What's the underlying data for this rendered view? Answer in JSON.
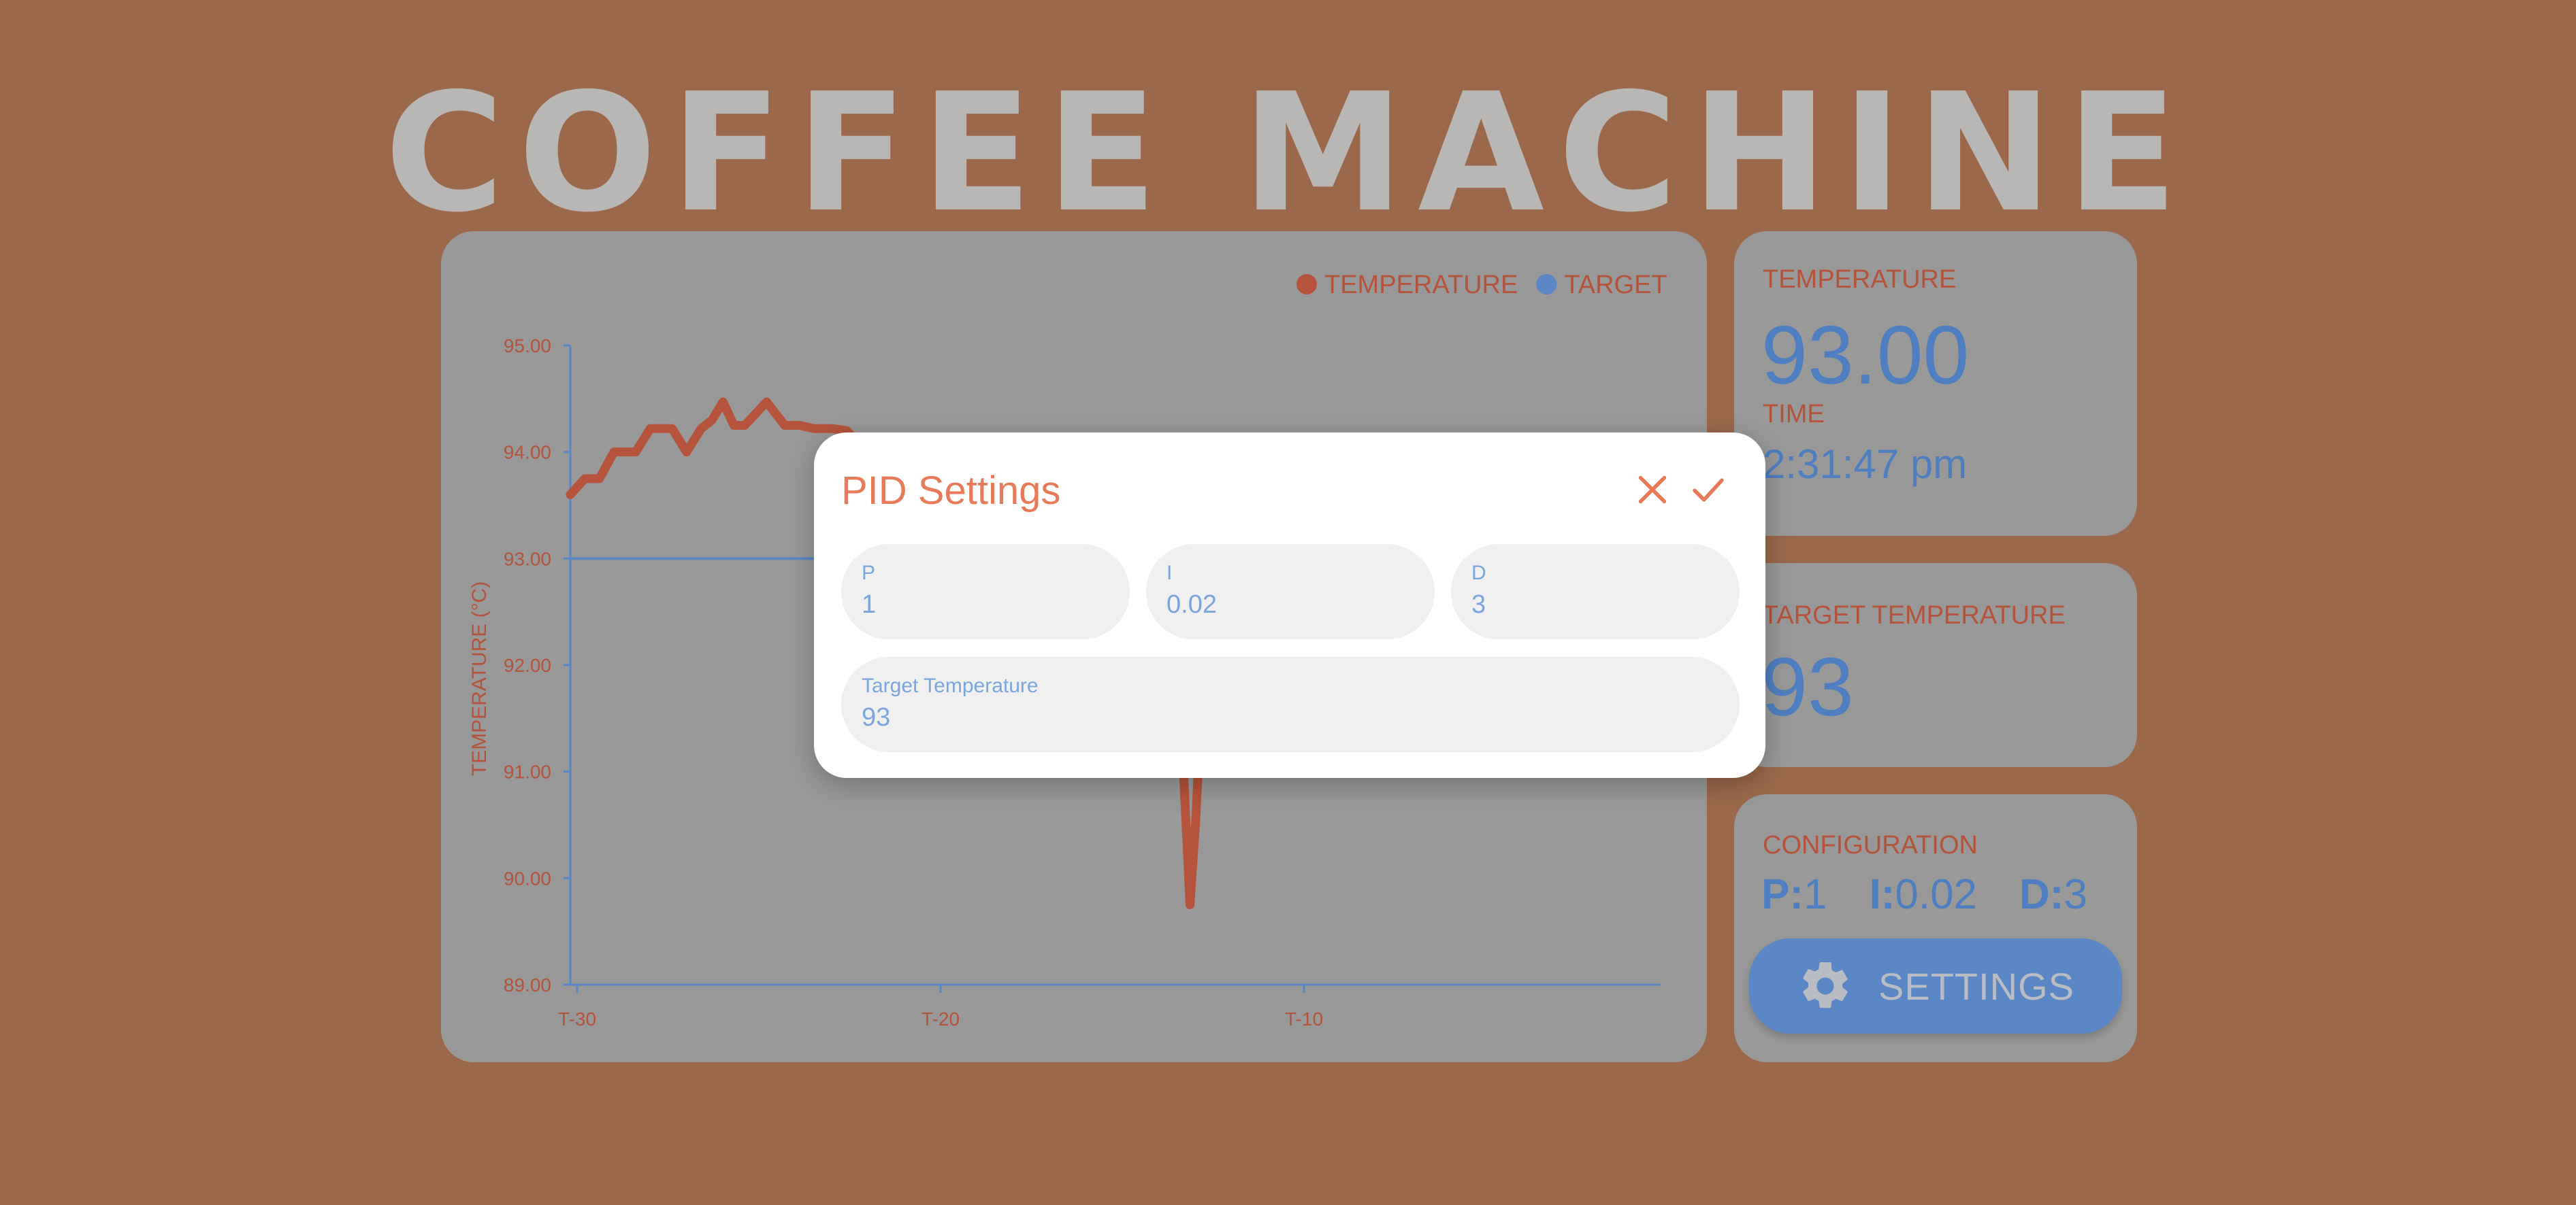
{
  "app_title": "COFFEE MACHINE",
  "colors": {
    "background": "#9b684b",
    "card": "#999999",
    "temperature_series": "#b5533c",
    "target_series": "#5b87c6",
    "accent_blue": "#4f7ec1",
    "dialog_accent": "#e77b59"
  },
  "chart_data": {
    "type": "line",
    "title": "",
    "xlabel": "",
    "ylabel": "TEMPERATURE (°C)",
    "ylim": [
      89,
      95
    ],
    "xlim": [
      -30,
      0
    ],
    "y_ticks": [
      "95.00",
      "94.00",
      "93.00",
      "92.00",
      "91.00",
      "90.00",
      "89.00"
    ],
    "x_ticks": [
      {
        "label": "T-30",
        "value": -30
      },
      {
        "label": "T-20",
        "value": -20
      },
      {
        "label": "T-10",
        "value": -10
      }
    ],
    "legend": {
      "placement": "top-right"
    },
    "series": [
      {
        "name": "TEMPERATURE",
        "color": "#b5533c",
        "x": [
          -30,
          -29.6,
          -29.2,
          -28.8,
          -28.2,
          -27.8,
          -27.2,
          -26.8,
          -26.4,
          -26.1,
          -25.8,
          -25.5,
          -25.2,
          -24.6,
          -24.1,
          -23.7,
          -23.3,
          -22.8,
          -22.4,
          -21.8,
          -21.3,
          -18.3,
          -14.8,
          -14.0,
          -13.5,
          -13.2,
          -12.95,
          -12.8,
          -12.6,
          -12.3,
          -11.8,
          -11.4
        ],
        "y": [
          93.6,
          93.75,
          93.75,
          94.0,
          94.0,
          94.22,
          94.22,
          94.0,
          94.22,
          94.3,
          94.47,
          94.25,
          94.25,
          94.47,
          94.25,
          94.25,
          94.22,
          94.22,
          94.2,
          94.0,
          93.6,
          93.1,
          93.0,
          92.8,
          92.5,
          91.5,
          89.75,
          90.5,
          91.8,
          92.7,
          92.95,
          93.0
        ]
      },
      {
        "name": "TARGET",
        "color": "#5b87c6",
        "x": [
          -30,
          -11
        ],
        "y": [
          93.0,
          93.0
        ]
      }
    ]
  },
  "temperature_card": {
    "label": "TEMPERATURE",
    "value": "93.00",
    "time_label": "TIME",
    "time_value": "2:31:47 pm"
  },
  "target_card": {
    "label": "TARGET TEMPERATURE",
    "value": "93"
  },
  "config_card": {
    "label": "CONFIGURATION",
    "p_key": "P:",
    "p_value": "1",
    "i_key": "I:",
    "i_value": "0.02",
    "d_key": "D:",
    "d_value": "3",
    "settings_label": "SETTINGS",
    "settings_icon": "gear-icon"
  },
  "dialog": {
    "title": "PID Settings",
    "close_icon": "close-icon",
    "confirm_icon": "check-icon",
    "fields": {
      "p": {
        "label": "P",
        "value": "1"
      },
      "i": {
        "label": "I",
        "value": "0.02"
      },
      "d": {
        "label": "D",
        "value": "3"
      },
      "target": {
        "label": "Target Temperature",
        "value": "93"
      }
    }
  }
}
